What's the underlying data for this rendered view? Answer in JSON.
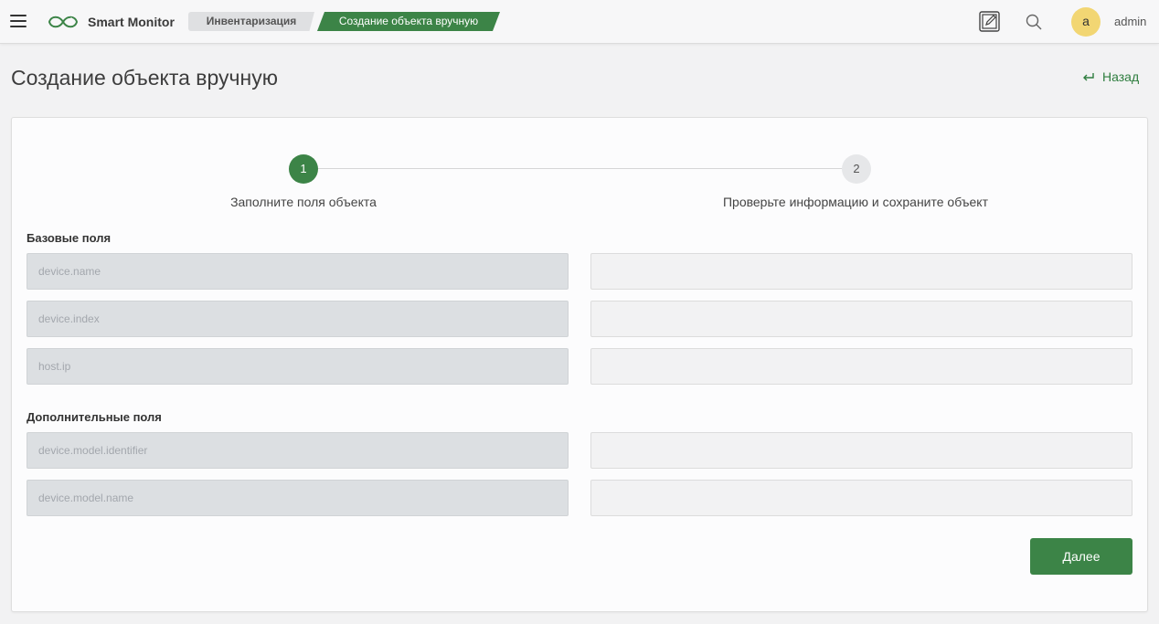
{
  "header": {
    "brand": "Smart Monitor",
    "breadcrumbs": [
      {
        "label": "Инвентаризация"
      },
      {
        "label": "Создание объекта вручную"
      }
    ],
    "avatar_letter": "a",
    "username": "admin",
    "icons": [
      "menu-icon",
      "logo-icon",
      "edit-note-icon",
      "search-icon"
    ]
  },
  "page": {
    "title": "Создание объекта вручную",
    "back_label": "Назад"
  },
  "stepper": {
    "steps": [
      {
        "number": "1",
        "label": "Заполните поля объекта",
        "active": true
      },
      {
        "number": "2",
        "label": "Проверьте информацию и сохраните объект",
        "active": false
      }
    ]
  },
  "sections": {
    "base": {
      "title": "Базовые поля",
      "fields": [
        {
          "key": "device.name",
          "value": ""
        },
        {
          "key": "device.index",
          "value": ""
        },
        {
          "key": "host.ip",
          "value": ""
        }
      ]
    },
    "extra": {
      "title": "Дополнительные поля",
      "fields": [
        {
          "key": "device.model.identifier",
          "value": ""
        },
        {
          "key": "device.model.name",
          "value": ""
        }
      ]
    }
  },
  "actions": {
    "next_label": "Далее"
  },
  "colors": {
    "accent": "#3c8447",
    "avatar": "#f2d673",
    "link": "#2e7d3e"
  }
}
